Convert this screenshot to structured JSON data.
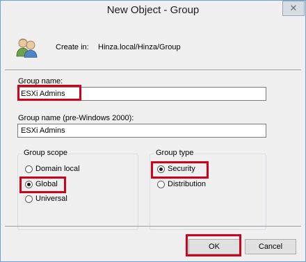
{
  "window": {
    "title": "New Object - Group",
    "close_glyph": "✕"
  },
  "header": {
    "icon": "users-group-icon",
    "create_in_label": "Create in:",
    "create_in_value": "Hinza.local/Hinza/Group"
  },
  "fields": {
    "group_name_label": "Group name:",
    "group_name_value": "ESXi Admins",
    "pre2000_label": "Group name (pre-Windows 2000):",
    "pre2000_value": "ESXi Admins"
  },
  "scope": {
    "title": "Group scope",
    "options": [
      {
        "label": "Domain local",
        "selected": false
      },
      {
        "label": "Global",
        "selected": true
      },
      {
        "label": "Universal",
        "selected": false
      }
    ]
  },
  "type": {
    "title": "Group type",
    "options": [
      {
        "label": "Security",
        "selected": true
      },
      {
        "label": "Distribution",
        "selected": false
      }
    ]
  },
  "buttons": {
    "ok": "OK",
    "cancel": "Cancel"
  },
  "colors": {
    "highlight": "#d0021b",
    "window_border": "#6aa2d6",
    "background": "#f0f0f0"
  }
}
